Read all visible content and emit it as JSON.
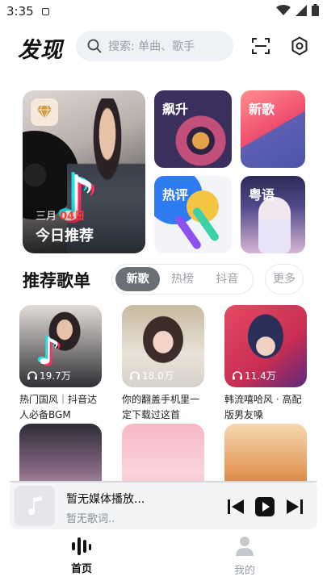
{
  "status_bar": {
    "time": "3:35"
  },
  "header": {
    "logo": "发现",
    "search_placeholder": "搜索: 单曲、歌手"
  },
  "banner": {
    "daily": {
      "month": "三月",
      "day": "04日",
      "title": "今日推荐"
    },
    "tiles": [
      {
        "label": "飙升"
      },
      {
        "label": "新歌"
      },
      {
        "label": "热评"
      },
      {
        "label": "粤语"
      }
    ]
  },
  "playlists_section": {
    "title": "推荐歌单",
    "tabs": [
      "新歌",
      "热榜",
      "抖音"
    ],
    "active_tab": "新歌",
    "more": "更多",
    "items": [
      {
        "plays": "19.7万",
        "name": "热门国风｜抖音达人必备BGM"
      },
      {
        "plays": "18.0万",
        "name": "你的翻盖手机里一定下载过这首"
      },
      {
        "plays": "11.4万",
        "name": "韩流嘻哈风 · 高配版男友嗓"
      }
    ]
  },
  "player": {
    "title": "暂无媒体播放...",
    "lyrics": "暂无歌词.."
  },
  "bottom_nav": {
    "items": [
      {
        "label": "首页",
        "active": true
      },
      {
        "label": "我的",
        "active": false
      }
    ]
  },
  "colors": {
    "accent_red": "#ff3b30",
    "tab_active_bg": "#6b6f76"
  }
}
